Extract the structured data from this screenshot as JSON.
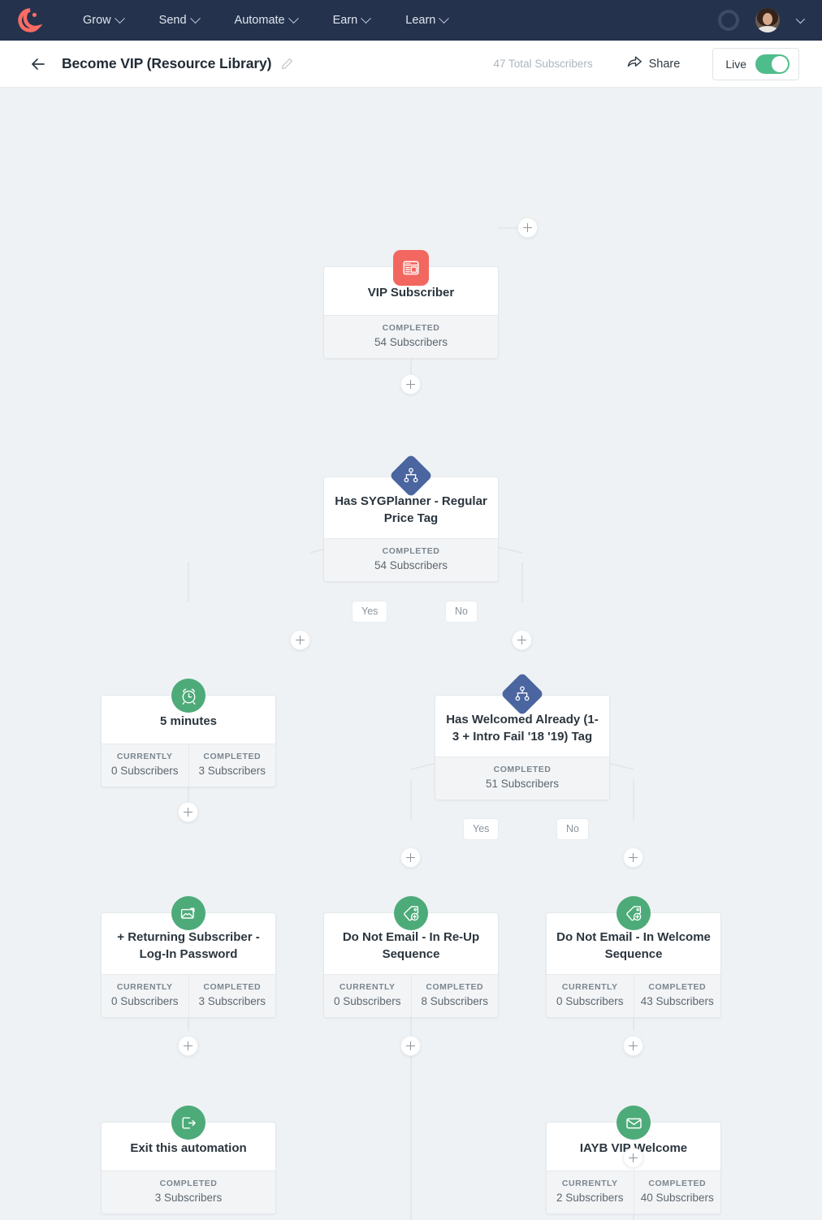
{
  "nav": {
    "logo_icon": "convertkit-logo-icon",
    "items": [
      {
        "label": "Grow",
        "icon": "chevron-down-icon"
      },
      {
        "label": "Send",
        "icon": "chevron-down-icon"
      },
      {
        "label": "Automate",
        "icon": "chevron-down-icon"
      },
      {
        "label": "Earn",
        "icon": "chevron-down-icon"
      },
      {
        "label": "Learn",
        "icon": "chevron-down-icon"
      }
    ],
    "right": {
      "ring_icon": "progress-ring-icon",
      "avatar_icon": "user-avatar",
      "caret_icon": "chevron-down-icon"
    },
    "background_color": "#24324d"
  },
  "subheader": {
    "back_icon": "back-arrow-icon",
    "title": "Become VIP (Resource Library)",
    "edit_icon": "pencil-edit-icon",
    "total_subscribers": "47 Total Subscribers",
    "share_label": "Share",
    "share_icon": "share-arrow-icon",
    "live_label": "Live",
    "live_on": true,
    "toggle_color": "#4fbd8b"
  },
  "canvas": {
    "background_color": "#eef2f5",
    "nodes": [
      {
        "id": "vip-subscriber",
        "title": "VIP Subscriber",
        "icon": "form-landing-page-icon",
        "badge_style": "square-red",
        "badge_color": "#f2675f",
        "stats": [
          {
            "label": "COMPLETED",
            "value": "54 Subscribers"
          }
        ]
      },
      {
        "id": "has-sygplanner-tag",
        "title": "Has SYGPlanner - Regular Price Tag",
        "icon": "condition-branch-icon",
        "badge_style": "diamond-blue",
        "badge_color": "#4a659f",
        "stats": [
          {
            "label": "COMPLETED",
            "value": "54 Subscribers"
          }
        ]
      },
      {
        "id": "five-minutes",
        "title": "5 minutes",
        "icon": "alarm-clock-icon",
        "badge_style": "circle-green",
        "badge_color": "#4dab79",
        "stats": [
          {
            "label": "CURRENTLY",
            "value": "0 Subscribers"
          },
          {
            "label": "COMPLETED",
            "value": "3 Subscribers"
          }
        ]
      },
      {
        "id": "has-welcomed-already",
        "title": "Has Welcomed Already (1-3 + Intro Fail '18 '19) Tag",
        "icon": "condition-branch-icon",
        "badge_style": "diamond-blue",
        "badge_color": "#4a659f",
        "stats": [
          {
            "label": "COMPLETED",
            "value": "51 Subscribers"
          }
        ]
      },
      {
        "id": "returning-subscriber-login-password",
        "title": "+ Returning Subscriber - Log-In Password",
        "icon": "email-tag-icon",
        "badge_style": "circle-green",
        "badge_color": "#4dab79",
        "stats": [
          {
            "label": "CURRENTLY",
            "value": "0 Subscribers"
          },
          {
            "label": "COMPLETED",
            "value": "3 Subscribers"
          }
        ]
      },
      {
        "id": "do-not-email-re-up",
        "title": "Do Not Email - In Re-Up Sequence",
        "icon": "add-tag-icon",
        "badge_style": "circle-green",
        "badge_color": "#4dab79",
        "stats": [
          {
            "label": "CURRENTLY",
            "value": "0 Subscribers"
          },
          {
            "label": "COMPLETED",
            "value": "8 Subscribers"
          }
        ]
      },
      {
        "id": "do-not-email-welcome",
        "title": "Do Not Email - In Welcome Sequence",
        "icon": "add-tag-icon",
        "badge_style": "circle-green",
        "badge_color": "#4dab79",
        "stats": [
          {
            "label": "CURRENTLY",
            "value": "0 Subscribers"
          },
          {
            "label": "COMPLETED",
            "value": "43 Subscribers"
          }
        ]
      },
      {
        "id": "exit-automation",
        "title": "Exit this automation",
        "icon": "exit-automation-icon",
        "badge_style": "circle-green",
        "badge_color": "#4dab79",
        "stats": [
          {
            "label": "COMPLETED",
            "value": "3 Subscribers"
          }
        ]
      },
      {
        "id": "iayb-vip-welcome",
        "title": "IAYB VIP Welcome",
        "icon": "envelope-email-icon",
        "badge_style": "circle-green",
        "badge_color": "#4dab79",
        "stats": [
          {
            "label": "CURRENTLY",
            "value": "2 Subscribers"
          },
          {
            "label": "COMPLETED",
            "value": "40 Subscribers"
          }
        ]
      }
    ],
    "branch_labels": [
      {
        "id": "sygplanner-yes",
        "text": "Yes"
      },
      {
        "id": "sygplanner-no",
        "text": "No"
      },
      {
        "id": "welcomed-yes",
        "text": "Yes"
      },
      {
        "id": "welcomed-no",
        "text": "No"
      }
    ],
    "add_step_icon": "plus-icon"
  }
}
